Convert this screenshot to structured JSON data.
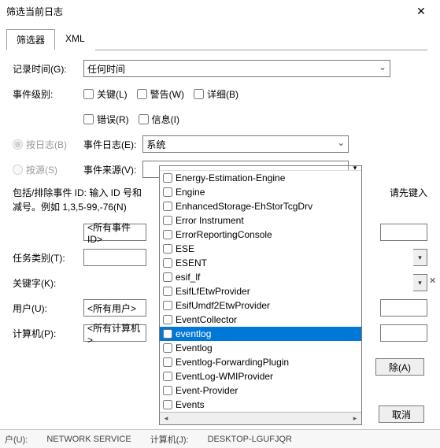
{
  "title": "筛选当前日志",
  "tabs": {
    "filter": "筛选器",
    "xml": "XML"
  },
  "labels": {
    "logged": "记录时间(G):",
    "level": "事件级别:",
    "byLog": "按日志(B)",
    "bySource": "按源(S)",
    "eventLog": "事件日志(E):",
    "eventSource": "事件来源(V):",
    "instr1": "包括/排除事件 ID: 输入 ID 号和",
    "instr2": "请先键入",
    "instr3": "减号。例如 1,3,5-99,-76(N)",
    "taskCat": "任务类别(T):",
    "keywords": "关键字(K):",
    "user": "用户(U):",
    "computer": "计算机(P):"
  },
  "values": {
    "anytime": "任何时间",
    "systemlog": "系统",
    "allEventIds": "<所有事件 ID>",
    "allUsers": "<所有用户>",
    "allComputers": "<所有计算机>"
  },
  "checks": {
    "critical": "关键(L)",
    "warning": "警告(W)",
    "verbose": "详细(B)",
    "error": "错误(R)",
    "info": "信息(I)"
  },
  "buttons": {
    "clear": "除(A)",
    "cancel": "取消"
  },
  "dropdown": {
    "items": [
      "Energy-Estimation-Engine",
      "Engine",
      "EnhancedStorage-EhStorTcgDrv",
      "Error Instrument",
      "ErrorReportingConsole",
      "ESE",
      "ESENT",
      "esif_lf",
      "EsifLfEtwProvider",
      "EsifUmdf2EtwProvider",
      "EventCollector",
      "eventlog",
      "Eventlog",
      "Eventlog-ForwardingPlugin",
      "EventLog-WMIProvider",
      "Event-Provider",
      "Events"
    ],
    "selectedIndex": 11
  },
  "statusbar": {
    "user": "户(U):",
    "nsvc": "NETWORK SERVICE",
    "comp": "计算机(J):",
    "desk": "DESKTOP-LGUFJQR"
  }
}
